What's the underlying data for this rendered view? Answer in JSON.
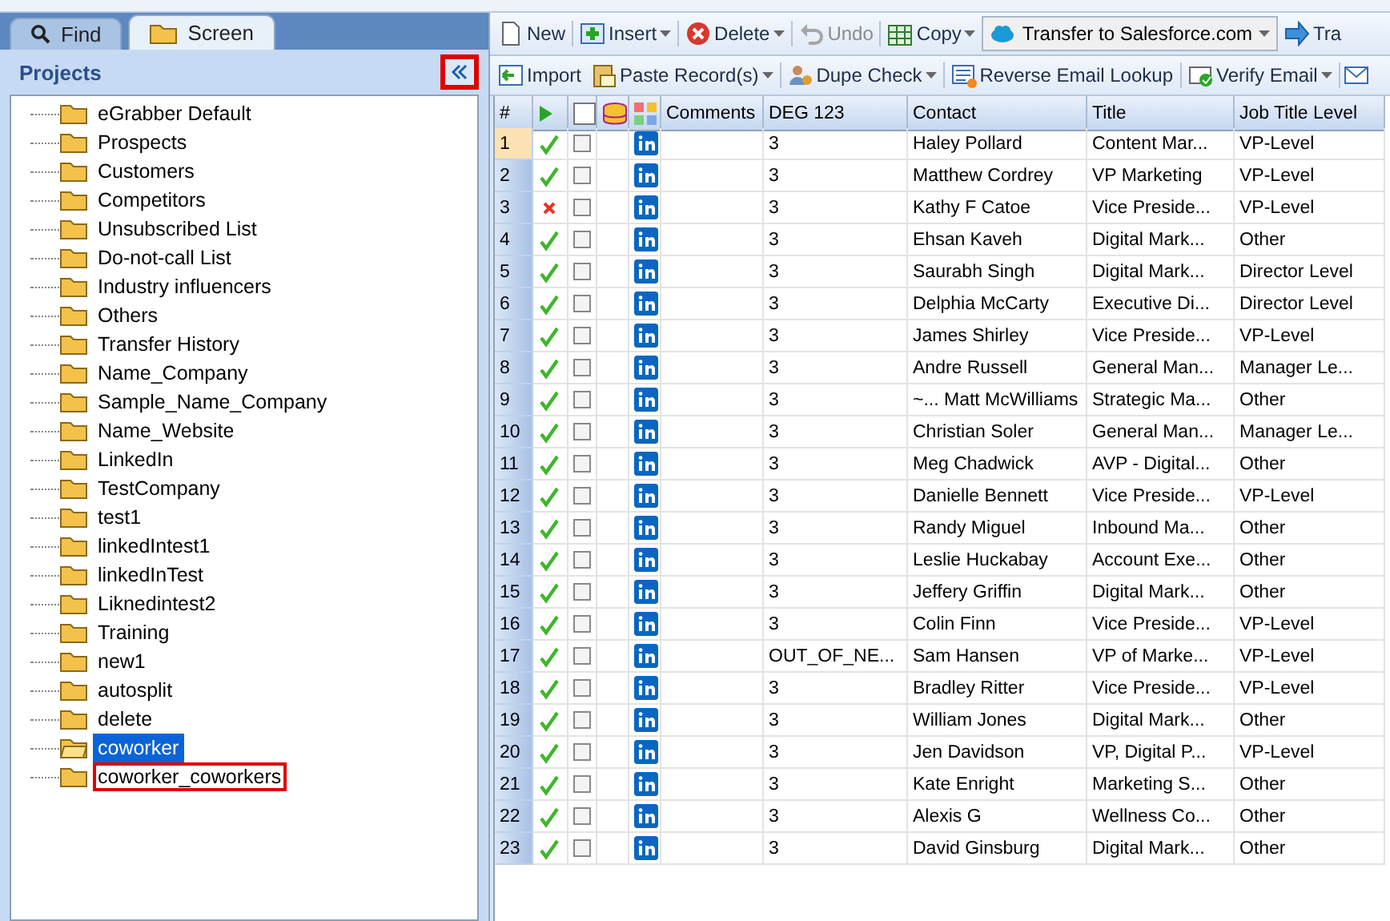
{
  "tabs": [
    {
      "label": "Find",
      "selected": false
    },
    {
      "label": "Screen",
      "selected": true
    }
  ],
  "projects": {
    "title": "Projects",
    "collapse_highlighted": true,
    "items": [
      {
        "label": "eGrabber Default",
        "selected": false,
        "highlighted": false
      },
      {
        "label": "Prospects",
        "selected": false,
        "highlighted": false
      },
      {
        "label": "Customers",
        "selected": false,
        "highlighted": false
      },
      {
        "label": "Competitors",
        "selected": false,
        "highlighted": false
      },
      {
        "label": "Unsubscribed List",
        "selected": false,
        "highlighted": false
      },
      {
        "label": "Do-not-call List",
        "selected": false,
        "highlighted": false
      },
      {
        "label": "Industry influencers",
        "selected": false,
        "highlighted": false
      },
      {
        "label": "Others",
        "selected": false,
        "highlighted": false
      },
      {
        "label": "Transfer History",
        "selected": false,
        "highlighted": false
      },
      {
        "label": "Name_Company",
        "selected": false,
        "highlighted": false
      },
      {
        "label": "Sample_Name_Company",
        "selected": false,
        "highlighted": false
      },
      {
        "label": "Name_Website",
        "selected": false,
        "highlighted": false
      },
      {
        "label": "LinkedIn",
        "selected": false,
        "highlighted": false
      },
      {
        "label": "TestCompany",
        "selected": false,
        "highlighted": false
      },
      {
        "label": "test1",
        "selected": false,
        "highlighted": false
      },
      {
        "label": "linkedIntest1",
        "selected": false,
        "highlighted": false
      },
      {
        "label": "linkedInTest",
        "selected": false,
        "highlighted": false
      },
      {
        "label": "Liknedintest2",
        "selected": false,
        "highlighted": false
      },
      {
        "label": "Training",
        "selected": false,
        "highlighted": false
      },
      {
        "label": "new1",
        "selected": false,
        "highlighted": false
      },
      {
        "label": "autosplit",
        "selected": false,
        "highlighted": false
      },
      {
        "label": "delete",
        "selected": false,
        "highlighted": false
      },
      {
        "label": "coworker",
        "selected": true,
        "highlighted": false
      },
      {
        "label": "coworker_coworkers",
        "selected": false,
        "highlighted": true
      }
    ]
  },
  "toolbar_1": [
    {
      "kind": "button",
      "label": "New",
      "menu": false,
      "disabled": false
    },
    {
      "kind": "button",
      "label": "Insert",
      "menu": true,
      "disabled": false
    },
    {
      "kind": "button",
      "label": "Delete",
      "menu": true,
      "disabled": false
    },
    {
      "kind": "button",
      "label": "Undo",
      "menu": false,
      "disabled": true
    },
    {
      "kind": "button",
      "label": "Copy",
      "menu": true,
      "disabled": false
    },
    {
      "kind": "select",
      "label": "Transfer to Salesforce.com",
      "menu": true,
      "disabled": false
    },
    {
      "kind": "button",
      "label": "Tra",
      "menu": false,
      "disabled": false
    }
  ],
  "toolbar_2": [
    {
      "label": "Import",
      "menu": false
    },
    {
      "label": "Paste Record(s)",
      "menu": true
    },
    {
      "label": "Dupe Check",
      "menu": true
    },
    {
      "label": "Reverse Email Lookup",
      "menu": false
    },
    {
      "label": "Verify Email",
      "menu": true
    }
  ],
  "table": {
    "all_checked": false,
    "columns": [
      "#",
      "Comments",
      "DEG 123",
      "Contact",
      "Title",
      "Job Title Level"
    ],
    "rows": [
      {
        "n": "1",
        "verified": true,
        "checked": false,
        "selected": true,
        "deg": "3",
        "contact": "Haley Pollard",
        "title": "Content Mar...",
        "level": "VP-Level"
      },
      {
        "n": "2",
        "verified": true,
        "checked": false,
        "selected": false,
        "deg": "3",
        "contact": "Matthew Cordrey",
        "title": "VP Marketing",
        "level": "VP-Level"
      },
      {
        "n": "3",
        "verified": false,
        "checked": false,
        "selected": false,
        "deg": "3",
        "contact": "Kathy F Catoe",
        "title": "Vice Preside...",
        "level": "VP-Level"
      },
      {
        "n": "4",
        "verified": true,
        "checked": false,
        "selected": false,
        "deg": "3",
        "contact": "Ehsan Kaveh",
        "title": "Digital Mark...",
        "level": "Other"
      },
      {
        "n": "5",
        "verified": true,
        "checked": false,
        "selected": false,
        "deg": "3",
        "contact": "Saurabh Singh",
        "title": "Digital Mark...",
        "level": "Director Level"
      },
      {
        "n": "6",
        "verified": true,
        "checked": false,
        "selected": false,
        "deg": "3",
        "contact": "Delphia McCarty",
        "title": "Executive Di...",
        "level": "Director Level"
      },
      {
        "n": "7",
        "verified": true,
        "checked": false,
        "selected": false,
        "deg": "3",
        "contact": "James Shirley",
        "title": "Vice Preside...",
        "level": "VP-Level"
      },
      {
        "n": "8",
        "verified": true,
        "checked": false,
        "selected": false,
        "deg": "3",
        "contact": "Andre Russell",
        "title": "General Man...",
        "level": "Manager Le..."
      },
      {
        "n": "9",
        "verified": true,
        "checked": false,
        "selected": false,
        "deg": "3",
        "contact": "~... Matt McWilliams",
        "title": "Strategic Ma...",
        "level": "Other"
      },
      {
        "n": "10",
        "verified": true,
        "checked": false,
        "selected": false,
        "deg": "3",
        "contact": "Christian Soler",
        "title": "General Man...",
        "level": "Manager Le..."
      },
      {
        "n": "11",
        "verified": true,
        "checked": false,
        "selected": false,
        "deg": "3",
        "contact": "Meg Chadwick",
        "title": "AVP - Digital...",
        "level": "Other"
      },
      {
        "n": "12",
        "verified": true,
        "checked": false,
        "selected": false,
        "deg": "3",
        "contact": "Danielle Bennett",
        "title": "Vice Preside...",
        "level": "VP-Level"
      },
      {
        "n": "13",
        "verified": true,
        "checked": false,
        "selected": false,
        "deg": "3",
        "contact": "Randy Miguel",
        "title": "Inbound Ma...",
        "level": "Other"
      },
      {
        "n": "14",
        "verified": true,
        "checked": false,
        "selected": false,
        "deg": "3",
        "contact": "Leslie Huckabay",
        "title": "Account Exe...",
        "level": "Other"
      },
      {
        "n": "15",
        "verified": true,
        "checked": false,
        "selected": false,
        "deg": "3",
        "contact": "Jeffery Griffin",
        "title": "Digital Mark...",
        "level": "Other"
      },
      {
        "n": "16",
        "verified": true,
        "checked": false,
        "selected": false,
        "deg": "3",
        "contact": "Colin Finn",
        "title": "Vice Preside...",
        "level": "VP-Level"
      },
      {
        "n": "17",
        "verified": true,
        "checked": false,
        "selected": false,
        "deg": "OUT_OF_NE...",
        "contact": "Sam Hansen",
        "title": "VP of Marke...",
        "level": "VP-Level"
      },
      {
        "n": "18",
        "verified": true,
        "checked": false,
        "selected": false,
        "deg": "3",
        "contact": "Bradley Ritter",
        "title": "Vice Preside...",
        "level": "VP-Level"
      },
      {
        "n": "19",
        "verified": true,
        "checked": false,
        "selected": false,
        "deg": "3",
        "contact": "William Jones",
        "title": "Digital Mark...",
        "level": "Other"
      },
      {
        "n": "20",
        "verified": true,
        "checked": false,
        "selected": false,
        "deg": "3",
        "contact": "Jen Davidson",
        "title": "VP, Digital P...",
        "level": "VP-Level"
      },
      {
        "n": "21",
        "verified": true,
        "checked": false,
        "selected": false,
        "deg": "3",
        "contact": "Kate Enright",
        "title": "Marketing S...",
        "level": "Other"
      },
      {
        "n": "22",
        "verified": true,
        "checked": false,
        "selected": false,
        "deg": "3",
        "contact": "Alexis G",
        "title": "Wellness Co...",
        "level": "Other"
      },
      {
        "n": "23",
        "verified": true,
        "checked": false,
        "selected": false,
        "deg": "3",
        "contact": "David Ginsburg",
        "title": "Digital Mark...",
        "level": "Other"
      }
    ]
  }
}
